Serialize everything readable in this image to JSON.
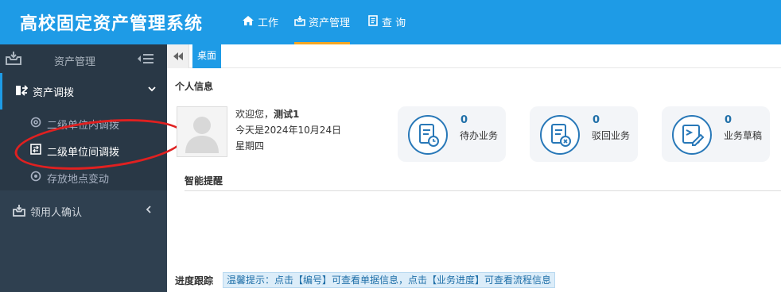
{
  "header": {
    "app_title": "高校固定资产管理系统",
    "nav": [
      {
        "label": "工作",
        "icon": "home-icon"
      },
      {
        "label": "资产管理",
        "icon": "inbox-icon"
      },
      {
        "label": "查 询",
        "icon": "document-icon"
      }
    ],
    "colors": {
      "header_bg": "#1e9be6",
      "active_underline": "#f5a623"
    }
  },
  "sidebar": {
    "title": "资产管理",
    "groups": [
      {
        "label": "资产调拨",
        "expanded": true,
        "items": [
          {
            "label": "二级单位内调拨",
            "icon": "at-icon"
          },
          {
            "label": "二级单位间调拨",
            "icon": "transfer-icon",
            "active": true
          },
          {
            "label": "存放地点变动",
            "icon": "circle-dot-icon"
          }
        ]
      },
      {
        "label": "领用人确认",
        "expanded": false
      }
    ]
  },
  "tabs": [
    {
      "label": "桌面",
      "active": true
    }
  ],
  "personal": {
    "section_title": "个人信息",
    "greeting": "欢迎您，",
    "user_name": "测试1",
    "date_line": "今天是2024年10月24日",
    "weekday": "星期四"
  },
  "stats": [
    {
      "value": "0",
      "label": "待办业务",
      "icon": "clock-doc-icon"
    },
    {
      "value": "0",
      "label": "驳回业务",
      "icon": "reject-doc-icon"
    },
    {
      "value": "0",
      "label": "业务草稿",
      "icon": "draft-doc-icon"
    }
  ],
  "reminder": {
    "title": "智能提醒"
  },
  "progress": {
    "title": "进度跟踪",
    "tip": "温馨提示：点击【编号】可查看单据信息，点击【业务进度】可查看流程信息"
  }
}
